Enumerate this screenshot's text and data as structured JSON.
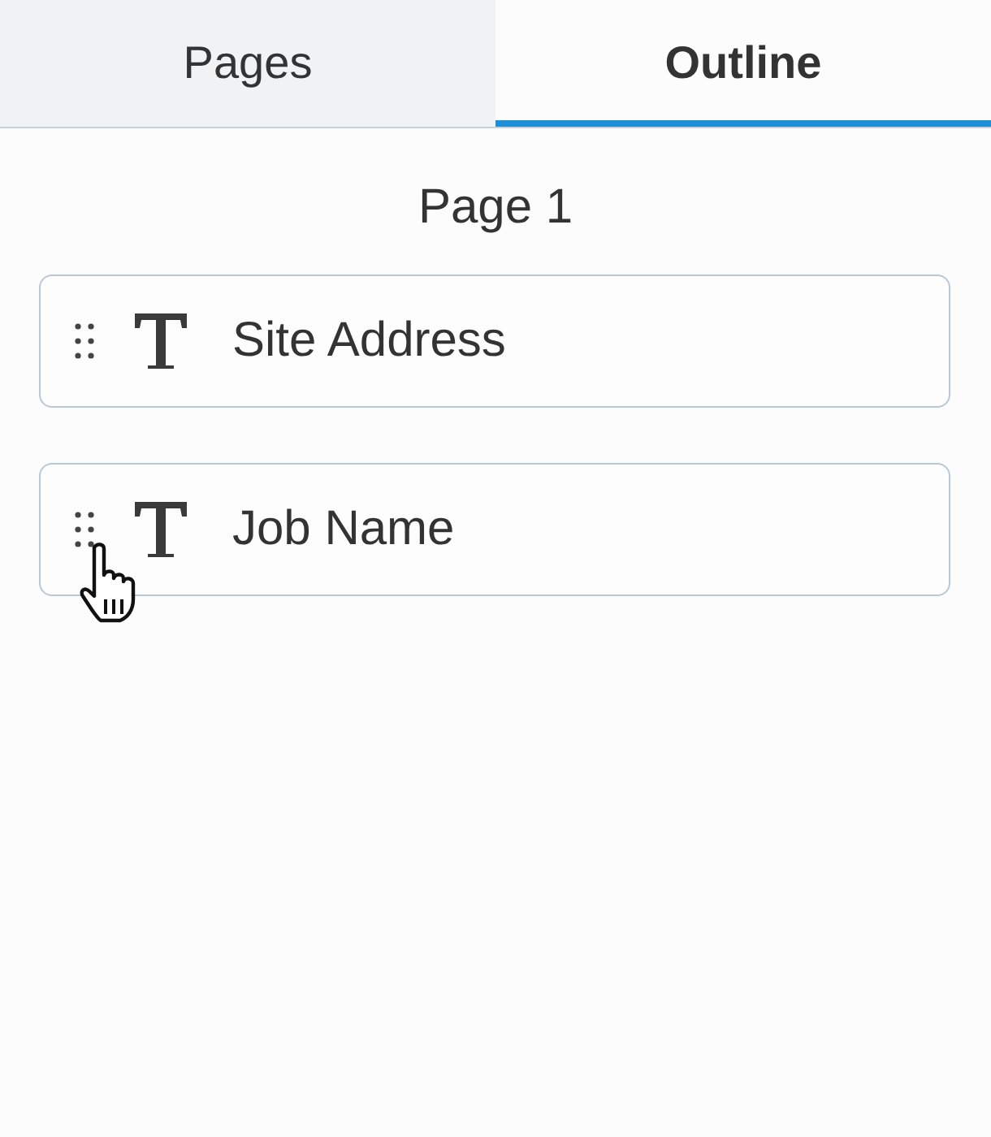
{
  "tabs": [
    {
      "label": "Pages",
      "selected": false
    },
    {
      "label": "Outline",
      "selected": true
    }
  ],
  "page_title": "Page 1",
  "fields": [
    {
      "label": "Site Address",
      "kind": "text"
    },
    {
      "label": "Job Name",
      "kind": "text"
    }
  ]
}
